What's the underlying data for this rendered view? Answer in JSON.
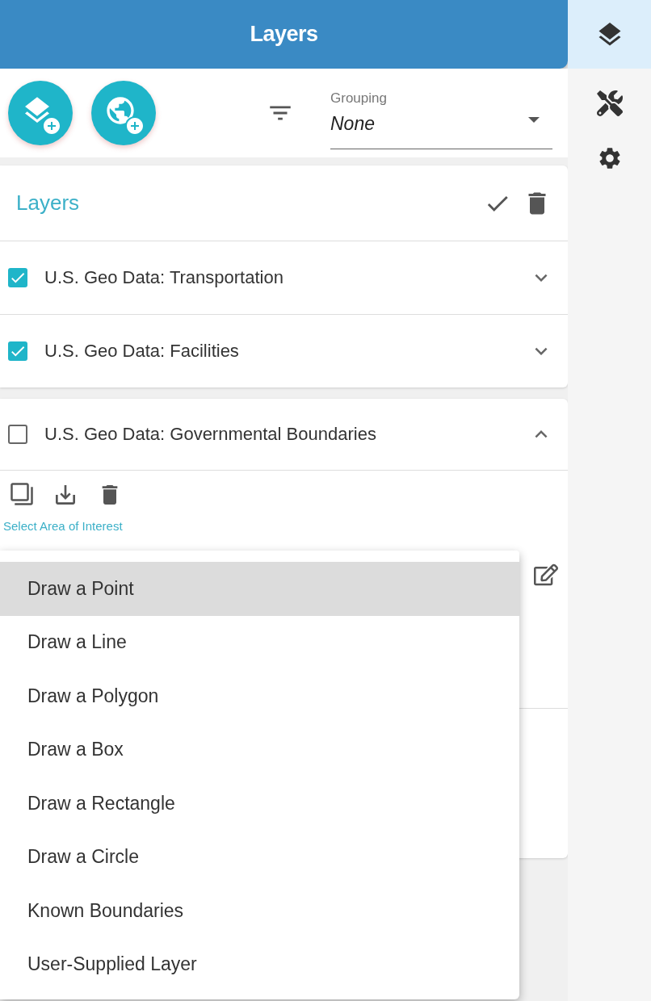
{
  "header": {
    "title": "Layers"
  },
  "sidebar": {
    "items": [
      {
        "kind": "layers",
        "selected": true
      },
      {
        "kind": "tools",
        "selected": false
      },
      {
        "kind": "settings",
        "selected": false
      }
    ]
  },
  "toolbar": {
    "grouping": {
      "label": "Grouping",
      "value": "None"
    }
  },
  "layers_card": {
    "title": "Layers"
  },
  "layers": [
    {
      "name": "U.S. Geo Data: Transportation",
      "checked": true,
      "expanded": false
    },
    {
      "name": "U.S. Geo Data: Facilities",
      "checked": true,
      "expanded": false
    },
    {
      "name": "U.S. Geo Data: Governmental Boundaries",
      "checked": false,
      "expanded": true
    }
  ],
  "area_select": {
    "label": "Select Area of Interest"
  },
  "menu": {
    "items": [
      {
        "label": "Draw a Point",
        "selected": true
      },
      {
        "label": "Draw a Line",
        "selected": false
      },
      {
        "label": "Draw a Polygon",
        "selected": false
      },
      {
        "label": "Draw a Box",
        "selected": false
      },
      {
        "label": "Draw a Rectangle",
        "selected": false
      },
      {
        "label": "Draw a Circle",
        "selected": false
      },
      {
        "label": "Known Boundaries",
        "selected": false
      },
      {
        "label": "User-Supplied Layer",
        "selected": false
      }
    ]
  }
}
